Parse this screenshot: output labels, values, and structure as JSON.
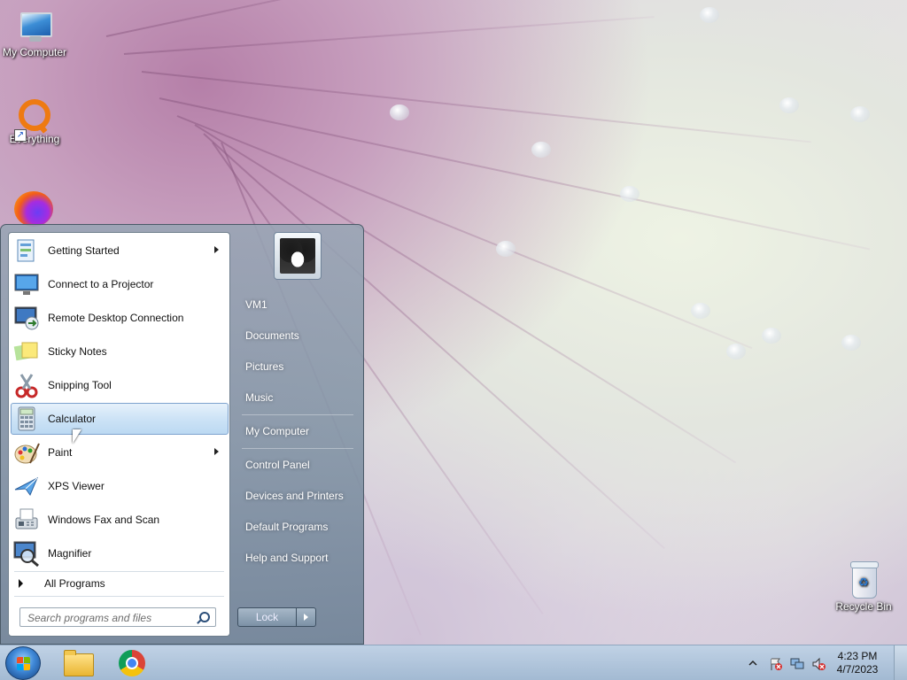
{
  "desktop": {
    "icons": [
      {
        "label": "My Computer"
      },
      {
        "label": "Everything"
      },
      {
        "label": "Recycle Bin"
      }
    ]
  },
  "start_menu": {
    "programs": [
      {
        "label": "Getting Started",
        "icon": "getting-started-icon",
        "has_submenu": true
      },
      {
        "label": "Connect to a Projector",
        "icon": "projector-icon",
        "has_submenu": false
      },
      {
        "label": "Remote Desktop Connection",
        "icon": "remote-desktop-icon",
        "has_submenu": false
      },
      {
        "label": "Sticky Notes",
        "icon": "sticky-notes-icon",
        "has_submenu": false
      },
      {
        "label": "Snipping Tool",
        "icon": "scissors-icon",
        "has_submenu": false
      },
      {
        "label": "Calculator",
        "icon": "calculator-icon",
        "has_submenu": false,
        "highlighted": true
      },
      {
        "label": "Paint",
        "icon": "paint-palette-icon",
        "has_submenu": true
      },
      {
        "label": "XPS Viewer",
        "icon": "xps-viewer-icon",
        "has_submenu": false
      },
      {
        "label": "Windows Fax and Scan",
        "icon": "fax-icon",
        "has_submenu": false
      },
      {
        "label": "Magnifier",
        "icon": "magnifier-icon",
        "has_submenu": false
      }
    ],
    "all_programs_label": "All Programs",
    "search_placeholder": "Search programs and files",
    "right_items": [
      {
        "label": "VM1"
      },
      {
        "label": "Documents"
      },
      {
        "label": "Pictures"
      },
      {
        "label": "Music"
      },
      {
        "label": "My Computer"
      },
      {
        "label": "Control Panel"
      },
      {
        "label": "Devices and Printers"
      },
      {
        "label": "Default Programs"
      },
      {
        "label": "Help and Support"
      }
    ],
    "lock_label": "Lock"
  },
  "taskbar": {
    "pinned": [
      {
        "icon": "windows-explorer-icon"
      },
      {
        "icon": "chrome-icon"
      }
    ],
    "tray_icons": [
      "show-hidden-icons-icon",
      "action-center-flag-icon",
      "network-icon",
      "volume-muted-icon"
    ],
    "clock_time": "4:23 PM",
    "clock_date": "4/7/2023"
  },
  "colors": {
    "highlight": "#cde3f6",
    "taskbar": "#a9c1da",
    "everything_orange": "#ee7a12"
  }
}
